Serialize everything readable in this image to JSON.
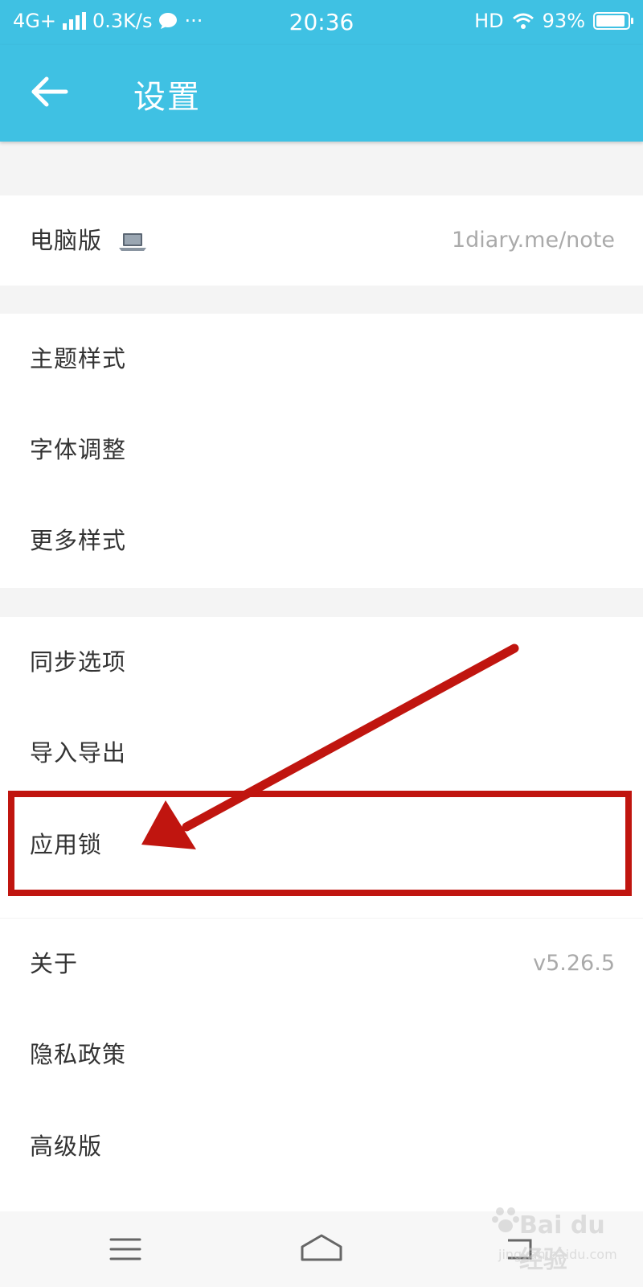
{
  "status_bar": {
    "network": "4G+",
    "speed": "0.3K/s",
    "extra": "···",
    "time": "20:36",
    "hd": "HD",
    "battery": "93%",
    "battery_level": 0.93
  },
  "header": {
    "title": "设置"
  },
  "sections": {
    "web": {
      "label": "电脑版",
      "value": "1diary.me/note"
    },
    "appearance": [
      "主题样式",
      "字体调整",
      "更多样式"
    ],
    "data": [
      "同步选项",
      "导入导出",
      "应用锁"
    ],
    "info": {
      "about_label": "关于",
      "about_value": "v5.26.5",
      "privacy_label": "隐私政策",
      "premium_label": "高级版"
    }
  },
  "watermark": {
    "brand": "Bai du 经验",
    "url": "jingyan.baidu.com"
  },
  "colors": {
    "accent": "#3fc1e3",
    "annotation": "#c0150f",
    "background": "#f4f4f4"
  },
  "icons": [
    "back-arrow-icon",
    "laptop-icon",
    "menu-icon",
    "home-icon",
    "back-nav-icon"
  ]
}
